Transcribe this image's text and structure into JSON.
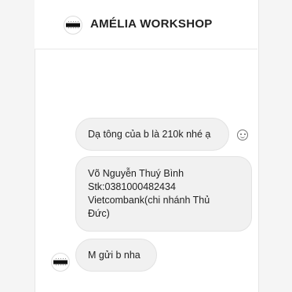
{
  "header": {
    "title": "AMÉLIA WORKSHOP"
  },
  "messages": [
    {
      "text": "Dạ tông của b là 210k nhé ạ"
    },
    {
      "lines": [
        "Võ Nguyễn Thuý Bình",
        "Stk:0381000482434",
        "Vietcombank(chi nhánh Thủ",
        "Đức)"
      ]
    },
    {
      "text": "M gửi b nha"
    }
  ]
}
